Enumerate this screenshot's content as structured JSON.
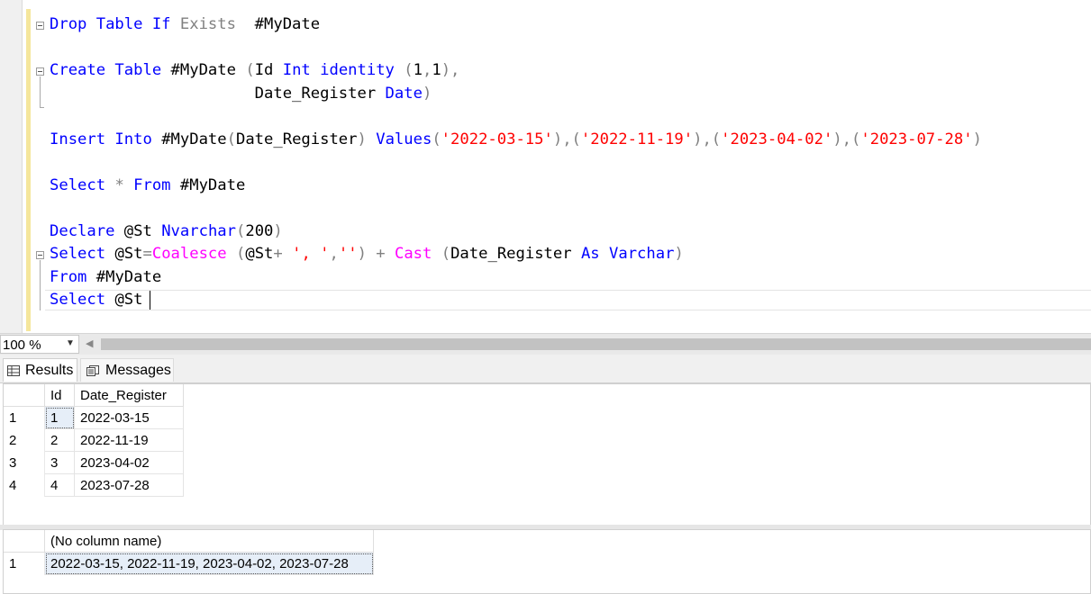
{
  "editor": {
    "lines": [
      [
        {
          "t": "Drop Table If ",
          "c": "kw"
        },
        {
          "t": "Exists",
          "c": "gray"
        },
        {
          "t": "  #MyDate",
          "c": "txt"
        }
      ],
      [
        {
          "t": "Create Table ",
          "c": "kw"
        },
        {
          "t": "#MyDate ",
          "c": "txt"
        },
        {
          "t": "(",
          "c": "gray"
        },
        {
          "t": "Id ",
          "c": "txt"
        },
        {
          "t": "Int identity ",
          "c": "kw"
        },
        {
          "t": "(",
          "c": "gray"
        },
        {
          "t": "1",
          "c": "txt"
        },
        {
          "t": ",",
          "c": "gray"
        },
        {
          "t": "1",
          "c": "txt"
        },
        {
          "t": "),",
          "c": "gray"
        }
      ],
      [
        {
          "t": "                      Date_Register ",
          "c": "txt"
        },
        {
          "t": "Date",
          "c": "kw"
        },
        {
          "t": ")",
          "c": "gray"
        }
      ],
      [
        {
          "t": "Insert Into ",
          "c": "kw"
        },
        {
          "t": "#MyDate",
          "c": "txt"
        },
        {
          "t": "(",
          "c": "gray"
        },
        {
          "t": "Date_Register",
          "c": "txt"
        },
        {
          "t": ") ",
          "c": "gray"
        },
        {
          "t": "Values",
          "c": "kw"
        },
        {
          "t": "(",
          "c": "gray"
        },
        {
          "t": "'2022-03-15'",
          "c": "str"
        },
        {
          "t": "),(",
          "c": "gray"
        },
        {
          "t": "'2022-11-19'",
          "c": "str"
        },
        {
          "t": "),(",
          "c": "gray"
        },
        {
          "t": "'2023-04-02'",
          "c": "str"
        },
        {
          "t": "),(",
          "c": "gray"
        },
        {
          "t": "'2023-07-28'",
          "c": "str"
        },
        {
          "t": ")",
          "c": "gray"
        }
      ],
      [
        {
          "t": "Select ",
          "c": "kw"
        },
        {
          "t": "* ",
          "c": "gray"
        },
        {
          "t": "From ",
          "c": "kw"
        },
        {
          "t": "#MyDate",
          "c": "txt"
        }
      ],
      [
        {
          "t": "Declare ",
          "c": "kw"
        },
        {
          "t": "@St ",
          "c": "txt"
        },
        {
          "t": "Nvarchar",
          "c": "kw"
        },
        {
          "t": "(",
          "c": "gray"
        },
        {
          "t": "200",
          "c": "txt"
        },
        {
          "t": ")",
          "c": "gray"
        }
      ],
      [
        {
          "t": "Select ",
          "c": "kw"
        },
        {
          "t": "@St",
          "c": "txt"
        },
        {
          "t": "=",
          "c": "gray"
        },
        {
          "t": "Coalesce ",
          "c": "fn"
        },
        {
          "t": "(",
          "c": "gray"
        },
        {
          "t": "@St",
          "c": "txt"
        },
        {
          "t": "+ ",
          "c": "gray"
        },
        {
          "t": "', '",
          "c": "str"
        },
        {
          "t": ",",
          "c": "gray"
        },
        {
          "t": "''",
          "c": "str"
        },
        {
          "t": ") + ",
          "c": "gray"
        },
        {
          "t": "Cast ",
          "c": "fn"
        },
        {
          "t": "(",
          "c": "gray"
        },
        {
          "t": "Date_Register ",
          "c": "txt"
        },
        {
          "t": "As ",
          "c": "kw"
        },
        {
          "t": "Varchar",
          "c": "kw"
        },
        {
          "t": ")",
          "c": "gray"
        }
      ],
      [
        {
          "t": "From ",
          "c": "kw"
        },
        {
          "t": "#MyDate",
          "c": "txt"
        }
      ],
      [
        {
          "t": "Select ",
          "c": "kw"
        },
        {
          "t": "@St",
          "c": "txt"
        }
      ]
    ]
  },
  "zoom": {
    "value": "100 %"
  },
  "tabs": {
    "results": "Results",
    "messages": "Messages"
  },
  "grid1": {
    "headers": [
      "Id",
      "Date_Register"
    ],
    "rows": [
      {
        "rn": "1",
        "id": "1",
        "date": "2022-03-15"
      },
      {
        "rn": "2",
        "id": "2",
        "date": "2022-11-19"
      },
      {
        "rn": "3",
        "id": "3",
        "date": "2023-04-02"
      },
      {
        "rn": "4",
        "id": "4",
        "date": "2023-07-28"
      }
    ]
  },
  "grid2": {
    "header": "(No column name)",
    "rows": [
      {
        "rn": "1",
        "value": "2022-03-15, 2022-11-19, 2023-04-02, 2023-07-28"
      }
    ]
  }
}
